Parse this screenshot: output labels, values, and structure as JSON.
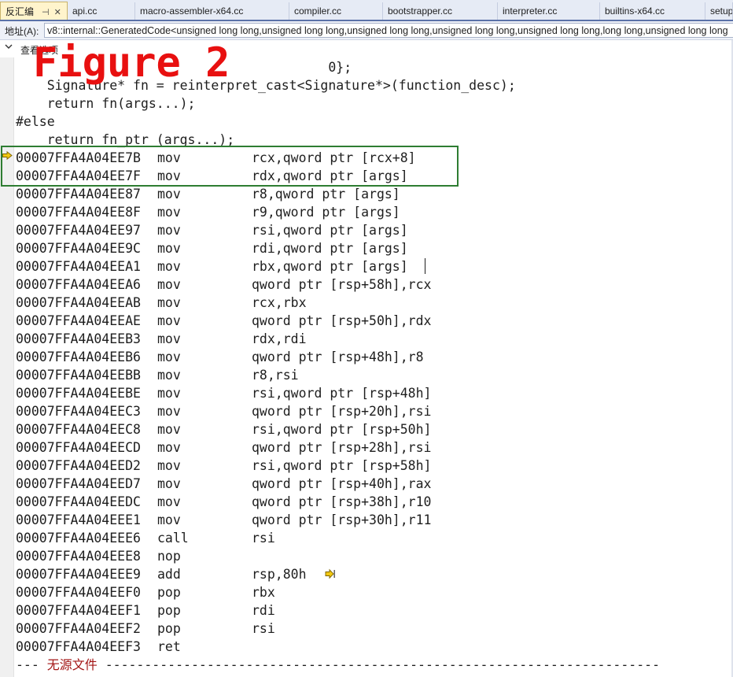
{
  "tabs": [
    {
      "label": "反汇编",
      "active": true,
      "pin": "⊣",
      "close": "✕"
    },
    {
      "label": "api.cc"
    },
    {
      "label": "macro-assembler-x64.cc"
    },
    {
      "label": "compiler.cc"
    },
    {
      "label": "bootstrapper.cc"
    },
    {
      "label": "interpreter.cc"
    },
    {
      "label": "builtins-x64.cc"
    },
    {
      "label": "setup"
    }
  ],
  "address": {
    "label": "地址(A):",
    "value": "v8::internal::GeneratedCode<unsigned long long,unsigned long long,unsigned long long,unsigned long long,unsigned long long,long long,unsigned long long"
  },
  "options": {
    "label": "查看选项",
    "chevron_icon": "chevron-down-icon"
  },
  "overlay": {
    "figure_label": "Figure 2"
  },
  "source_lines": [
    "                                        0};",
    "    Signature* fn = reinterpret_cast<Signature*>(function_desc);",
    "    return fn(args...);",
    "#else",
    "    return fn_ptr (args...);"
  ],
  "instructions": [
    {
      "addr": "00007FFA4A04EE7B",
      "mnemonic": "mov",
      "operands": "rcx,qword ptr [rcx+8]"
    },
    {
      "addr": "00007FFA4A04EE7F",
      "mnemonic": "mov",
      "operands": "rdx,qword ptr [args]"
    },
    {
      "addr": "00007FFA4A04EE87",
      "mnemonic": "mov",
      "operands": "r8,qword ptr [args]"
    },
    {
      "addr": "00007FFA4A04EE8F",
      "mnemonic": "mov",
      "operands": "r9,qword ptr [args]"
    },
    {
      "addr": "00007FFA4A04EE97",
      "mnemonic": "mov",
      "operands": "rsi,qword ptr [args]"
    },
    {
      "addr": "00007FFA4A04EE9C",
      "mnemonic": "mov",
      "operands": "rdi,qword ptr [args]"
    },
    {
      "addr": "00007FFA4A04EEA1",
      "mnemonic": "mov",
      "operands": "rbx,qword ptr [args]"
    },
    {
      "addr": "00007FFA4A04EEA6",
      "mnemonic": "mov",
      "operands": "qword ptr [rsp+58h],rcx"
    },
    {
      "addr": "00007FFA4A04EEAB",
      "mnemonic": "mov",
      "operands": "rcx,rbx"
    },
    {
      "addr": "00007FFA4A04EEAE",
      "mnemonic": "mov",
      "operands": "qword ptr [rsp+50h],rdx"
    },
    {
      "addr": "00007FFA4A04EEB3",
      "mnemonic": "mov",
      "operands": "rdx,rdi"
    },
    {
      "addr": "00007FFA4A04EEB6",
      "mnemonic": "mov",
      "operands": "qword ptr [rsp+48h],r8"
    },
    {
      "addr": "00007FFA4A04EEBB",
      "mnemonic": "mov",
      "operands": "r8,rsi"
    },
    {
      "addr": "00007FFA4A04EEBE",
      "mnemonic": "mov",
      "operands": "rsi,qword ptr [rsp+48h]"
    },
    {
      "addr": "00007FFA4A04EEC3",
      "mnemonic": "mov",
      "operands": "qword ptr [rsp+20h],rsi"
    },
    {
      "addr": "00007FFA4A04EEC8",
      "mnemonic": "mov",
      "operands": "rsi,qword ptr [rsp+50h]"
    },
    {
      "addr": "00007FFA4A04EECD",
      "mnemonic": "mov",
      "operands": "qword ptr [rsp+28h],rsi"
    },
    {
      "addr": "00007FFA4A04EED2",
      "mnemonic": "mov",
      "operands": "rsi,qword ptr [rsp+58h]"
    },
    {
      "addr": "00007FFA4A04EED7",
      "mnemonic": "mov",
      "operands": "qword ptr [rsp+40h],rax"
    },
    {
      "addr": "00007FFA4A04EEDC",
      "mnemonic": "mov",
      "operands": "qword ptr [rsp+38h],r10"
    },
    {
      "addr": "00007FFA4A04EEE1",
      "mnemonic": "mov",
      "operands": "qword ptr [rsp+30h],r11"
    },
    {
      "addr": "00007FFA4A04EEE6",
      "mnemonic": "call",
      "operands": "rsi"
    },
    {
      "addr": "00007FFA4A04EEE8",
      "mnemonic": "nop",
      "operands": ""
    },
    {
      "addr": "00007FFA4A04EEE9",
      "mnemonic": "add",
      "operands": "rsp,80h"
    },
    {
      "addr": "00007FFA4A04EEF0",
      "mnemonic": "pop",
      "operands": "rbx"
    },
    {
      "addr": "00007FFA4A04EEF1",
      "mnemonic": "pop",
      "operands": "rdi"
    },
    {
      "addr": "00007FFA4A04EEF2",
      "mnemonic": "pop",
      "operands": "rsi"
    },
    {
      "addr": "00007FFA4A04EEF3",
      "mnemonic": "ret",
      "operands": ""
    }
  ],
  "footer": {
    "prefix": "--- ",
    "no_source_label": "无源文件",
    "dashes": " -----------------------------------------------------------------------"
  },
  "colors": {
    "figure_label": "#e81010",
    "highlight_box": "#2e7d32",
    "exec_arrow": "#f2c811",
    "no_source_text": "#a31515"
  }
}
